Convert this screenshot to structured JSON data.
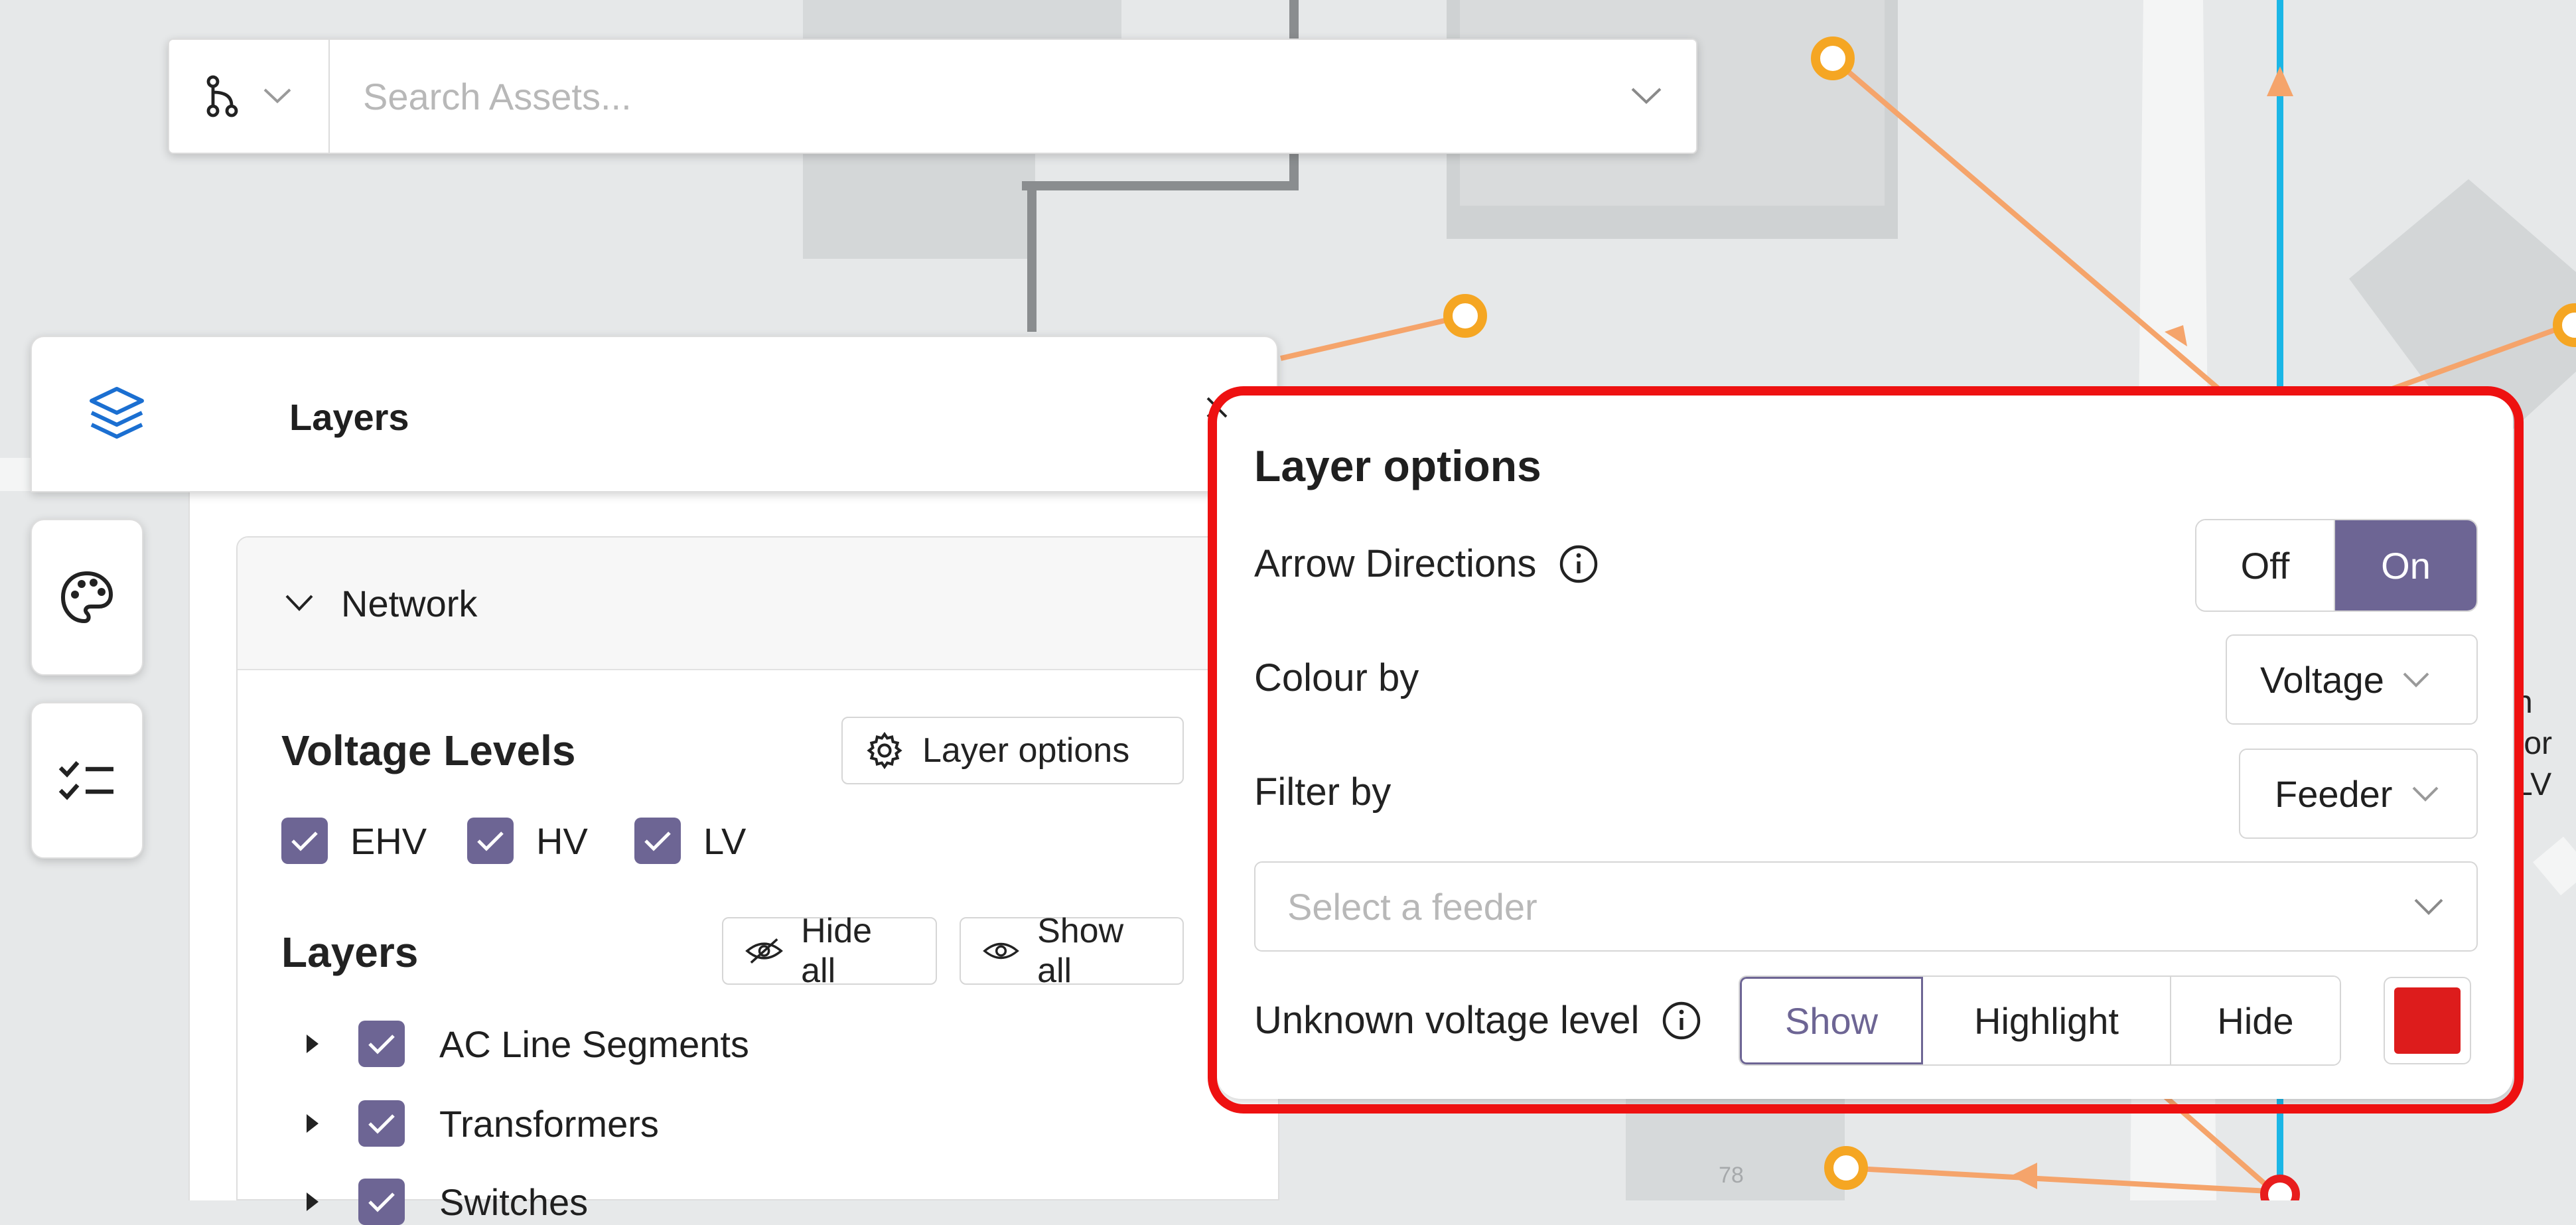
{
  "colors": {
    "accent": "#6d6594",
    "highlight_frame": "#ee1111",
    "unknown_voltage_swatch": "#dd1c1c",
    "map_line_orange": "#f5a46b",
    "map_line_blue": "#1bb6e6",
    "map_node": "#f5a623"
  },
  "search": {
    "placeholder": "Search Assets...",
    "scope_icon": "branch-icon"
  },
  "layers_panel": {
    "title": "Layers",
    "sidebar_icons": [
      "layers-icon",
      "palette-icon",
      "checklist-icon"
    ],
    "network": {
      "label": "Network",
      "voltage_levels": {
        "title": "Voltage Levels",
        "layer_options_label": "Layer options",
        "items": [
          {
            "label": "EHV",
            "checked": true
          },
          {
            "label": "HV",
            "checked": true
          },
          {
            "label": "LV",
            "checked": true
          }
        ]
      },
      "layers": {
        "title": "Layers",
        "hide_all_label": "Hide all",
        "show_all_label": "Show all",
        "items": [
          {
            "label": "AC Line Segments",
            "checked": true
          },
          {
            "label": "Transformers",
            "checked": true
          },
          {
            "label": "Switches",
            "checked": true
          }
        ]
      }
    }
  },
  "layer_options": {
    "title": "Layer options",
    "arrow_directions": {
      "label": "Arrow Directions",
      "off": "Off",
      "on": "On",
      "selected": "On"
    },
    "colour_by": {
      "label": "Colour by",
      "value": "Voltage"
    },
    "filter_by": {
      "label": "Filter by",
      "value": "Feeder"
    },
    "feeder_select": {
      "placeholder": "Select a feeder"
    },
    "unknown_voltage": {
      "label": "Unknown voltage level",
      "show": "Show",
      "highlight": "Highlight",
      "hide": "Hide",
      "selected": "Show"
    }
  },
  "map_labels": {
    "partial_text": [
      "h",
      "tor",
      "LV"
    ],
    "road_number": "78"
  }
}
